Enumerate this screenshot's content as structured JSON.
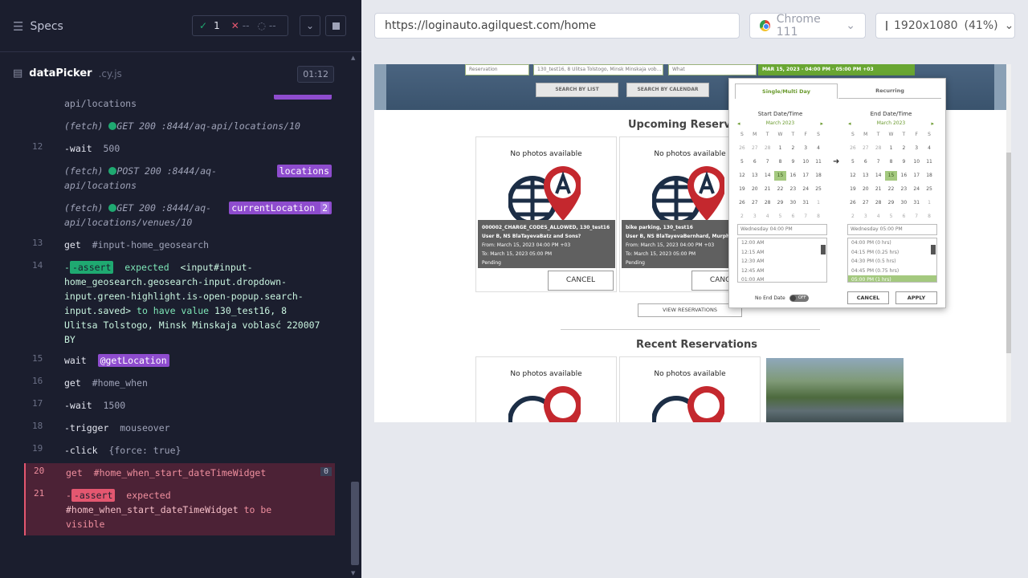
{
  "specs": {
    "title": "Specs",
    "passed": "1",
    "failed": "--",
    "pending": "--",
    "file_name": "dataPicker",
    "file_ext": ".cy.js",
    "timer": "01:12"
  },
  "log": {
    "l0": "api/locations",
    "l1_type": "(fetch)",
    "l1_text": "GET 200 :8444/aq-api/locations/10",
    "l2_num": "12",
    "l2_name": "-wait",
    "l2_msg": "500",
    "l3_type": "(fetch)",
    "l3_text_a": "POST 200 :8444/aq-",
    "l3_text_b": "api/locations",
    "l3_tag": "locations",
    "l4_type": "(fetch)",
    "l4_text_a": "GET 200 :8444/aq-",
    "l4_text_b": "api/locations/venues/10",
    "l4_tag": "currentLocation",
    "l4_count": "2",
    "l5_num": "13",
    "l5_name": "get",
    "l5_msg": "#input-home_geosearch",
    "l6_num": "14",
    "l6_name": "-assert",
    "l6_msg_a": "expected",
    "l6_msg_b": "<input#input-",
    "l6_msg_c": "home_geosearch.geosearch-input.dropdown-",
    "l6_msg_d": "input.green-highlight.is-open-popup.search-",
    "l6_msg_e": "input.saved>",
    "l6_msg_f": "to have value",
    "l6_msg_g": "130_test16, 8",
    "l6_msg_h": "Ulitsa Tolstogo, Minsk Minskaja voblasć 220007",
    "l6_msg_i": "BY",
    "l7_num": "15",
    "l7_name": "wait",
    "l7_tag": "@getLocation",
    "l8_num": "16",
    "l8_name": "get",
    "l8_msg": "#home_when",
    "l9_num": "17",
    "l9_name": "-wait",
    "l9_msg": "1500",
    "l10_num": "18",
    "l10_name": "-trigger",
    "l10_msg": "mouseover",
    "l11_num": "19",
    "l11_name": "-click",
    "l11_msg": "{force: true}",
    "l12_num": "20",
    "l12_name": "get",
    "l12_msg": "#home_when_start_dateTimeWidget",
    "l12_count": "0",
    "l13_num": "21",
    "l13_name": "-assert",
    "l13_msg_a": "expected",
    "l13_msg_b": "#home_when_start_dateTimeWidget",
    "l13_msg_c": "to be",
    "l13_msg_d": "visible"
  },
  "browser": {
    "url": "https://loginauto.agilquest.com/home",
    "name": "Chrome 111",
    "viewport": "1920x1080",
    "scale": "(41%)"
  },
  "app": {
    "type_select": "Reservation",
    "location_value": "130_test16, 8 Ulitsa Tolstogo, Minsk Minskaja vob...",
    "what_select": "What",
    "when_value": "MAR 15, 2023 - 04:00 PM - 05:00 PM +03",
    "search_list": "SEARCH BY LIST",
    "search_calendar": "SEARCH BY CALENDAR",
    "upcoming_title": "Upcoming Reservations",
    "no_photos": "No photos available",
    "card1": {
      "title": "000002_CHARGE_CODES_ALLOWED, 130_test16",
      "user": "User B, NS BlaTayevaBatz and Sons?",
      "from": "From: March 15, 2023 04:00 PM +03",
      "to": "To: March 15, 2023 05:00 PM",
      "status": "Pending",
      "cancel": "CANCEL"
    },
    "card2": {
      "title": "bike parking, 130_test16",
      "user": "User B, NS BlaTayevaBernhard, Murphy and",
      "from": "From: March 15, 2023 04:00 PM +03",
      "to": "To: March 15, 2023 05:00 PM",
      "status": "Pending",
      "cancel": "CANCEL"
    },
    "view_reservations": "VIEW RESERVATIONS",
    "recent_title": "Recent Reservations"
  },
  "picker": {
    "tab_single": "Single/Multi Day",
    "tab_recurring": "Recurring",
    "start_title": "Start Date/Time",
    "end_title": "End Date/Time",
    "month": "March 2023",
    "weekdays": [
      "S",
      "M",
      "T",
      "W",
      "T",
      "F",
      "S"
    ],
    "days": [
      [
        "26",
        "27",
        "28",
        "1",
        "2",
        "3",
        "4"
      ],
      [
        "5",
        "6",
        "7",
        "8",
        "9",
        "10",
        "11"
      ],
      [
        "12",
        "13",
        "14",
        "15",
        "16",
        "17",
        "18"
      ],
      [
        "19",
        "20",
        "21",
        "22",
        "23",
        "24",
        "25"
      ],
      [
        "26",
        "27",
        "28",
        "29",
        "30",
        "31",
        "1"
      ],
      [
        "2",
        "3",
        "4",
        "5",
        "6",
        "7",
        "8"
      ]
    ],
    "selected_day": "15",
    "start_time_value": "Wednesday 04:00 PM",
    "end_time_value": "Wednesday 05:00 PM",
    "start_times": [
      "12:00 AM",
      "12:15 AM",
      "12:30 AM",
      "12:45 AM",
      "01:00 AM"
    ],
    "end_times": [
      "04:00 PM (0 hrs)",
      "04:15 PM (0.25 hrs)",
      "04:30 PM (0.5 hrs)",
      "04:45 PM (0.75 hrs)",
      "05:00 PM (1 hrs)"
    ],
    "no_end_date": "No End Date",
    "toggle": "OFF",
    "cancel": "CANCEL",
    "apply": "APPLY"
  },
  "colors": {
    "pass": "#1fa971",
    "fail": "#e45770",
    "alias": "#8e4cce",
    "brand_green": "#69a632"
  }
}
